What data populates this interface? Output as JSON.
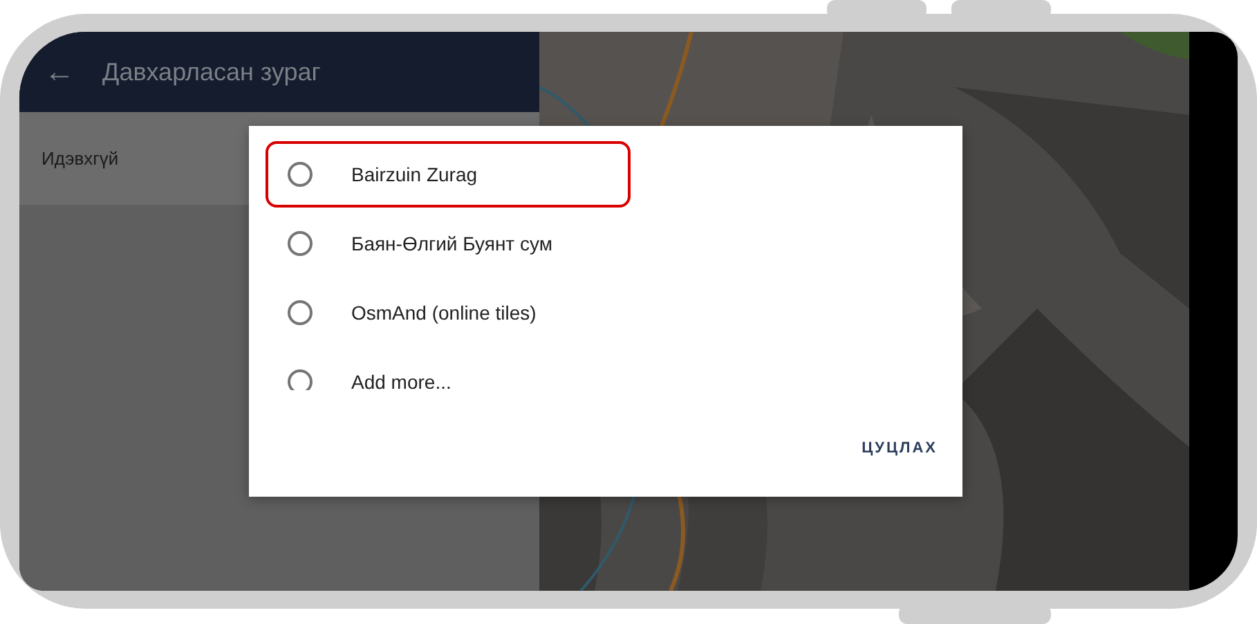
{
  "header": {
    "back": "←",
    "title": "Давхарласан зураг"
  },
  "settings": [
    {
      "label": "Идэвхгүй"
    }
  ],
  "dialog": {
    "options": [
      {
        "label": "Bairzuin Zurag",
        "selected": false,
        "highlighted": true
      },
      {
        "label": "Баян-Өлгий Буянт сум",
        "selected": false,
        "highlighted": false
      },
      {
        "label": "OsmAnd (online tiles)",
        "selected": false,
        "highlighted": false
      },
      {
        "label": "Add more...",
        "selected": false,
        "highlighted": false
      }
    ],
    "button": "ЦУЦЛАХ"
  }
}
